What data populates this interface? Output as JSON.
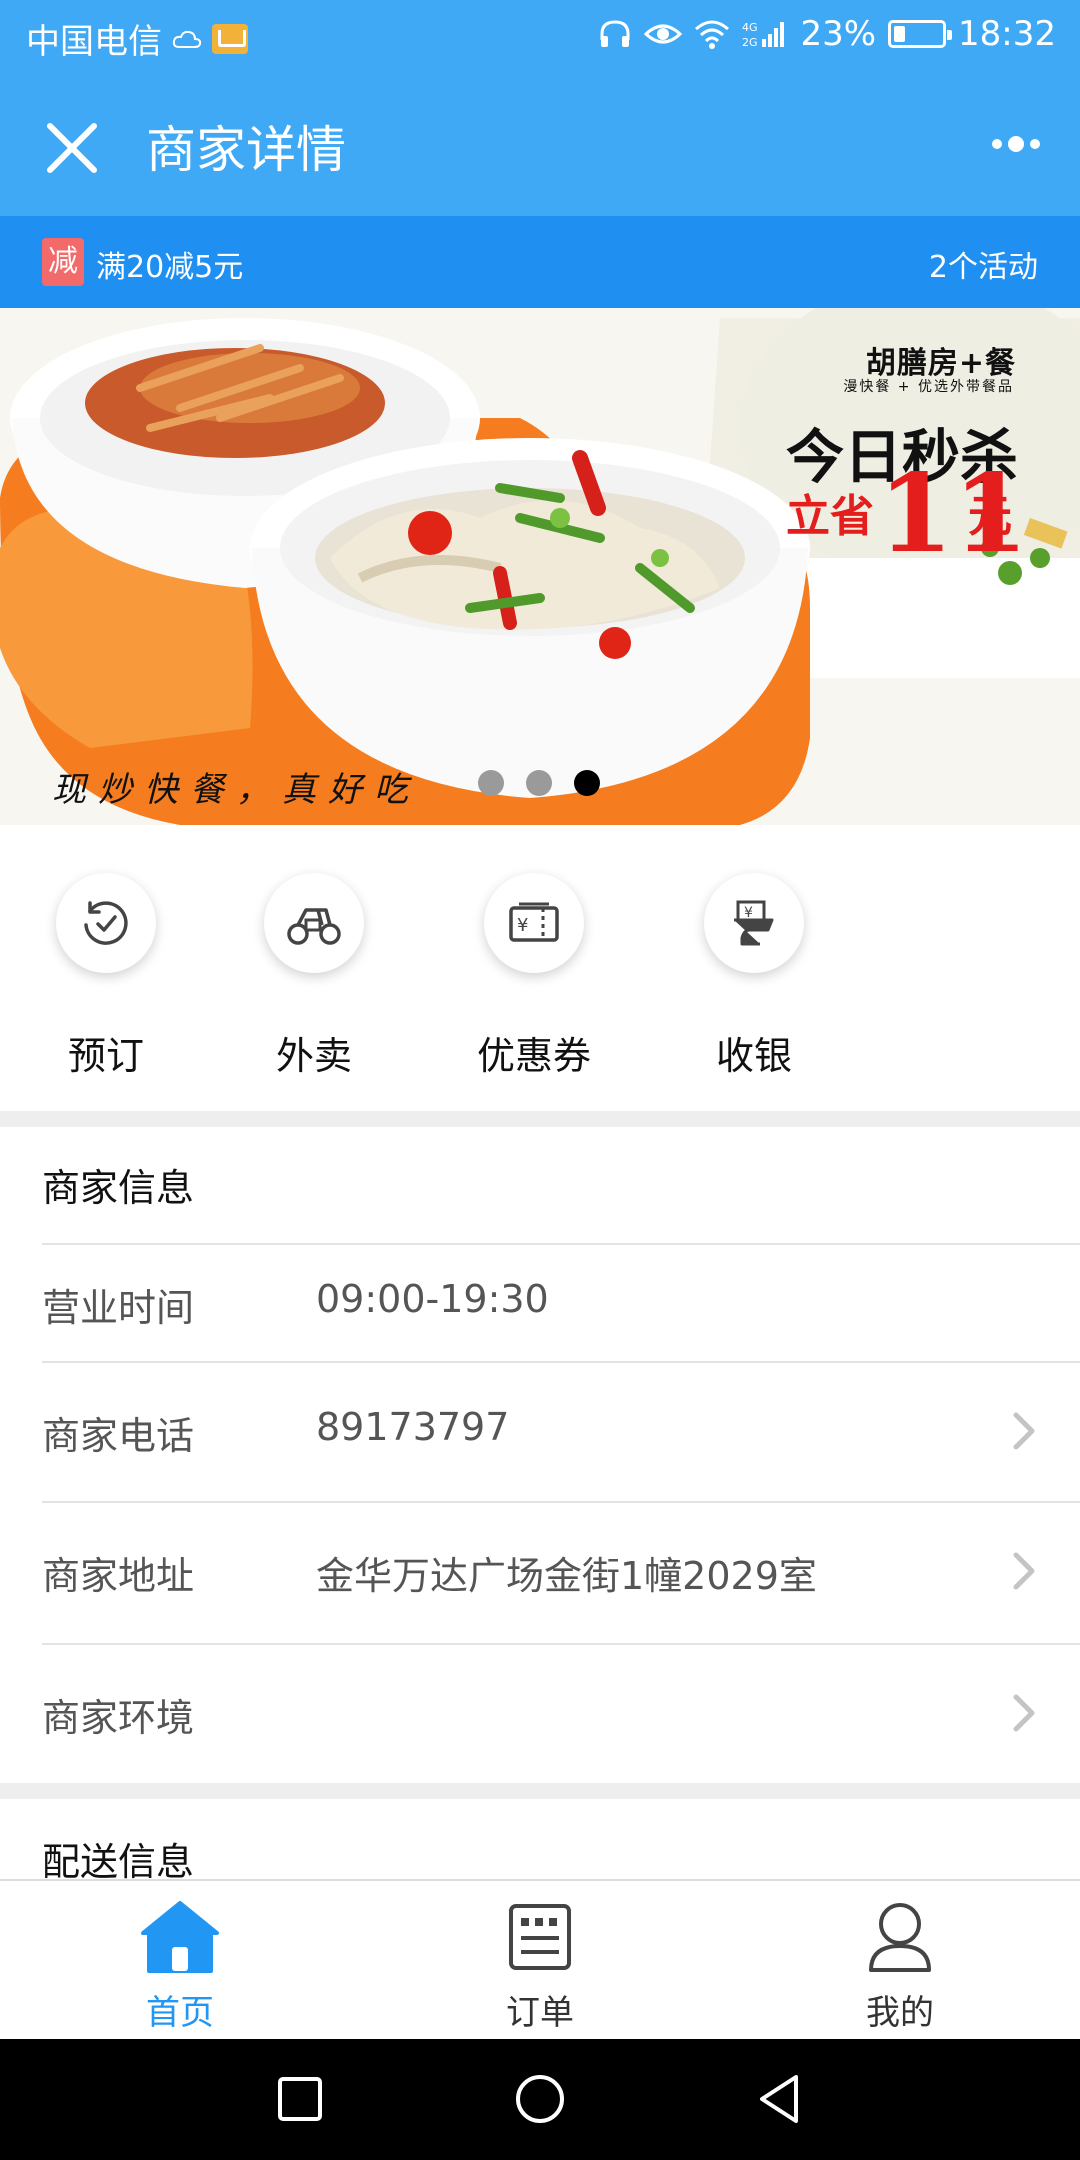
{
  "status_bar": {
    "carrier": "中国电信",
    "network": "4G 2G",
    "battery_percent": "23%",
    "battery_level": 0.23,
    "time": "18:32"
  },
  "header": {
    "title": "商家详情",
    "close_icon": "close-icon",
    "more_icon": "more-icon"
  },
  "promo": {
    "tag": "减",
    "text": "满20减5元",
    "count": "2个活动",
    "colors": {
      "strip": "#1f8ff2",
      "tag": "#f36a6a"
    }
  },
  "banner": {
    "brand": "胡膳房+餐",
    "brand_sub": "漫快餐 + 优选外带餐品",
    "headline": "今日秒杀",
    "save_prefix": "立省",
    "save_amount": "11",
    "save_unit": "元",
    "slogan": "现炒快餐，真好吃",
    "slide_count": 3,
    "active_slide": 3
  },
  "quick_actions": [
    {
      "label": "预订",
      "icon": "clock-check-icon"
    },
    {
      "label": "外卖",
      "icon": "scooter-icon"
    },
    {
      "label": "优惠券",
      "icon": "coupon-icon"
    },
    {
      "label": "收银",
      "icon": "cashier-icon"
    }
  ],
  "merchant_info": {
    "title": "商家信息",
    "rows": [
      {
        "key": "营业时间",
        "value": "09:00-19:30",
        "has_arrow": false
      },
      {
        "key": "商家电话",
        "value": "89173797",
        "has_arrow": true
      },
      {
        "key": "商家地址",
        "value": "金华万达广场金街1幢2029室",
        "has_arrow": true
      },
      {
        "key": "商家环境",
        "value": "",
        "has_arrow": true
      }
    ]
  },
  "delivery_info": {
    "title": "配送信息"
  },
  "tab_bar": [
    {
      "label": "首页",
      "icon": "home-icon",
      "active": true
    },
    {
      "label": "订单",
      "icon": "order-icon",
      "active": false
    },
    {
      "label": "我的",
      "icon": "profile-icon",
      "active": false
    }
  ],
  "colors": {
    "primary": "#40a9f5",
    "active_tab": "#2196f3",
    "offer_red": "#e41d1d"
  }
}
